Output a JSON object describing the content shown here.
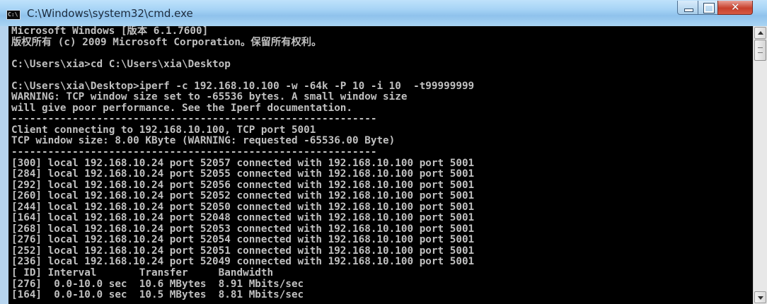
{
  "window": {
    "title": "C:\\Windows\\system32\\cmd.exe",
    "icon": "cmd-app-icon",
    "icon_text": "C:\\",
    "controls": {
      "minimize": "minimize-icon",
      "maximize": "maximize-icon",
      "close": "close-icon",
      "close_glyph": "✕"
    }
  },
  "console": {
    "lines": [
      "Microsoft Windows [版本 6.1.7600]",
      "版权所有 (c) 2009 Microsoft Corporation。保留所有权利。",
      "",
      "C:\\Users\\xia>cd C:\\Users\\xia\\Desktop",
      "",
      "C:\\Users\\xia\\Desktop>iperf -c 192.168.10.100 -w -64k -P 10 -i 10  -t99999999",
      "WARNING: TCP window size set to -65536 bytes. A small window size",
      "will give poor performance. See the Iperf documentation.",
      "------------------------------------------------------------",
      "Client connecting to 192.168.10.100, TCP port 5001",
      "TCP window size: 8.00 KByte (WARNING: requested -65536.00 Byte)",
      "------------------------------------------------------------",
      "[300] local 192.168.10.24 port 52057 connected with 192.168.10.100 port 5001",
      "[284] local 192.168.10.24 port 52055 connected with 192.168.10.100 port 5001",
      "[292] local 192.168.10.24 port 52056 connected with 192.168.10.100 port 5001",
      "[260] local 192.168.10.24 port 52052 connected with 192.168.10.100 port 5001",
      "[244] local 192.168.10.24 port 52050 connected with 192.168.10.100 port 5001",
      "[164] local 192.168.10.24 port 52048 connected with 192.168.10.100 port 5001",
      "[268] local 192.168.10.24 port 52053 connected with 192.168.10.100 port 5001",
      "[276] local 192.168.10.24 port 52054 connected with 192.168.10.100 port 5001",
      "[252] local 192.168.10.24 port 52051 connected with 192.168.10.100 port 5001",
      "[236] local 192.168.10.24 port 52049 connected with 192.168.10.100 port 5001",
      "[ ID] Interval       Transfer     Bandwidth",
      "[276]  0.0-10.0 sec  10.6 MBytes  8.91 Mbits/sec",
      "[164]  0.0-10.0 sec  10.5 MBytes  8.81 Mbits/sec"
    ]
  }
}
